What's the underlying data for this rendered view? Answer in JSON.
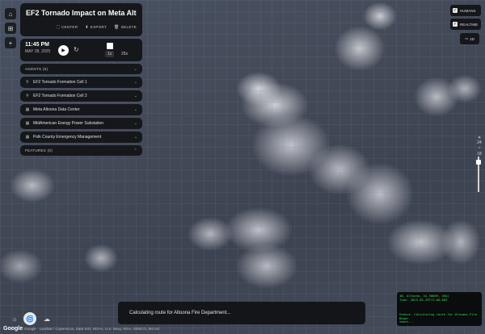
{
  "header": {
    "title": "EF2 Tornado Impact on Meta Altoon...",
    "actions": [
      {
        "icon": "center-icon",
        "label": "CENTER"
      },
      {
        "icon": "export-icon",
        "label": "EXPORT"
      },
      {
        "icon": "trash-icon",
        "label": "DELETE"
      }
    ]
  },
  "playback": {
    "time": "11:45 PM",
    "date": "MAY 28, 2025",
    "speed_1": "1x",
    "speed_2": "25x"
  },
  "agents": {
    "header": "AGENTS (5)",
    "items": [
      {
        "label": "EF2 Tornado Formation Cell 1",
        "icon": "pin-icon"
      },
      {
        "label": "EF2 Tornado Formation Cell 2",
        "icon": "pin-icon"
      },
      {
        "label": "Meta Altoona Data Center",
        "icon": "building-icon"
      },
      {
        "label": "MidAmerican Energy Power Substation",
        "icon": "building-icon"
      },
      {
        "label": "Polk County Emergency Management",
        "icon": "building-icon"
      }
    ]
  },
  "features": {
    "header": "FEATURES (0)"
  },
  "toggles": {
    "humans": "HUMANS",
    "realtime": "REALTIME",
    "mode_2d": "2D"
  },
  "slider": {
    "top_value": "24",
    "mid_value": "18"
  },
  "status": {
    "message": "Calculating route for Altoona Fire Department..."
  },
  "attribution": {
    "logo": "Google",
    "text": "Google · Landsat / Copernicus, Data SIO, NOAA, U.S. Navy, NGA, GEBCO, IBCAO"
  },
  "terminal": {
    "lines": [
      "1N, Altoona, IA 50009, USA)",
      "  Time: 2025-05-29T11:00:00Z",
      "",
      "",
      "",
      "Status: Calculating route for Altoona Fire Depar",
      "tment..."
    ]
  }
}
